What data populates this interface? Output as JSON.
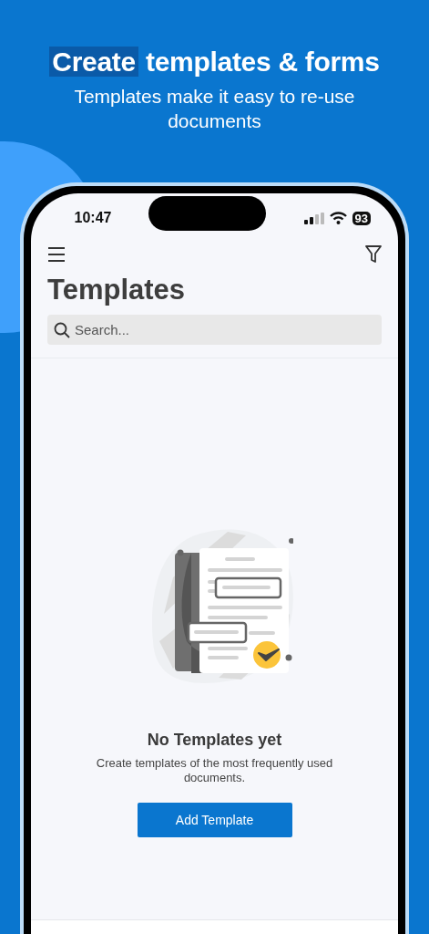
{
  "headline": {
    "highlighted": "Create",
    "rest": "templates & forms"
  },
  "subtitle": "Templates make it easy to re-use documents",
  "status_bar": {
    "time": "10:47",
    "battery": "93"
  },
  "page_title": "Templates",
  "search": {
    "placeholder": "Search..."
  },
  "empty_state": {
    "title": "No Templates yet",
    "description": "Create templates of the most frequently used documents.",
    "button": "Add Template"
  }
}
